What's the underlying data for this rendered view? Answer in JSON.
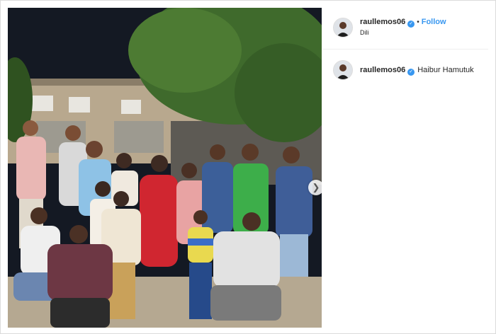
{
  "post": {
    "username": "raullemos06",
    "follow_label": "Follow",
    "separator": "•",
    "location": "Dili",
    "verified_icon": "verified-badge-icon",
    "next_icon": "chevron-right-icon",
    "caption": {
      "username": "raullemos06",
      "text": "Haibur Hamutuk"
    }
  },
  "colors": {
    "accent": "#3897f0",
    "text": "#262626",
    "divider": "#efefef"
  }
}
